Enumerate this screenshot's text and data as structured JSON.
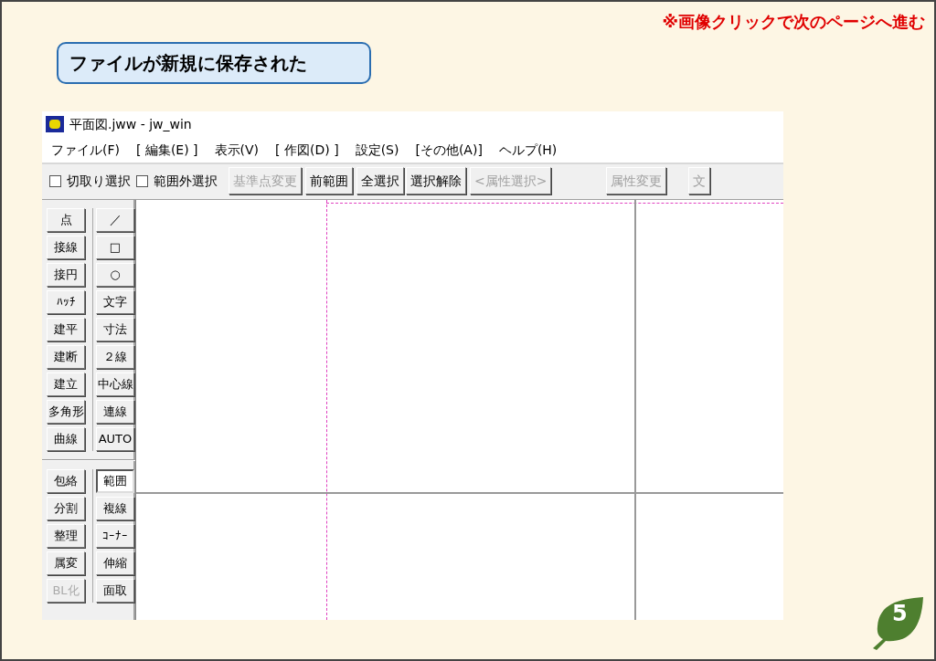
{
  "note": "※画像クリックで次のページへ進む",
  "heading": "ファイルが新規に保存された",
  "window": {
    "title": "平面図.jww - jw_win"
  },
  "menu": [
    {
      "label": "ファイル(F)"
    },
    {
      "label": "[ 編集(E) ]"
    },
    {
      "label": "表示(V)"
    },
    {
      "label": "[ 作図(D) ]"
    },
    {
      "label": "設定(S)"
    },
    {
      "label": "[その他(A)]"
    },
    {
      "label": "ヘルプ(H)"
    }
  ],
  "toolbar": [
    {
      "kind": "checkbox",
      "label": "切取り選択",
      "checked": false
    },
    {
      "kind": "checkbox",
      "label": "範囲外選択",
      "checked": false
    },
    {
      "kind": "button",
      "label": "基準点変更",
      "disabled": true
    },
    {
      "kind": "button",
      "label": "前範囲",
      "disabled": false
    },
    {
      "kind": "button",
      "label": "全選択",
      "disabled": false
    },
    {
      "kind": "button",
      "label": "選択解除",
      "disabled": false
    },
    {
      "kind": "button",
      "label": "<属性選択>",
      "disabled": true
    },
    {
      "kind": "button",
      "label": "属性変更",
      "disabled": true
    },
    {
      "kind": "button",
      "label": "文",
      "disabled": true
    }
  ],
  "tool_groups": [
    {
      "left": [
        {
          "label": "点",
          "disabled": false
        },
        {
          "label": "接線",
          "disabled": false
        },
        {
          "label": "接円",
          "disabled": false
        },
        {
          "label": "ﾊｯﾁ",
          "disabled": false
        },
        {
          "label": "建平",
          "disabled": false
        },
        {
          "label": "建断",
          "disabled": false
        },
        {
          "label": "建立",
          "disabled": false
        },
        {
          "label": "多角形",
          "disabled": false
        },
        {
          "label": "曲線",
          "disabled": false
        }
      ],
      "right": [
        {
          "label": "／",
          "selected": false
        },
        {
          "label": "□",
          "selected": false
        },
        {
          "label": "○",
          "selected": false
        },
        {
          "label": "文字",
          "selected": false
        },
        {
          "label": "寸法",
          "selected": false
        },
        {
          "label": "２線",
          "selected": false
        },
        {
          "label": "中心線",
          "selected": false
        },
        {
          "label": "連線",
          "selected": false
        },
        {
          "label": "AUTO",
          "selected": false
        }
      ]
    },
    {
      "left": [
        {
          "label": "包絡",
          "disabled": false
        },
        {
          "label": "分割",
          "disabled": false
        },
        {
          "label": "整理",
          "disabled": false
        },
        {
          "label": "属変",
          "disabled": false
        },
        {
          "label": "BL化",
          "disabled": true
        }
      ],
      "right": [
        {
          "label": "範囲",
          "selected": true
        },
        {
          "label": "複線",
          "selected": false
        },
        {
          "label": "ｺｰﾅｰ",
          "selected": false
        },
        {
          "label": "伸縮",
          "selected": false
        },
        {
          "label": "面取",
          "selected": false
        }
      ]
    }
  ],
  "page_number": "5"
}
